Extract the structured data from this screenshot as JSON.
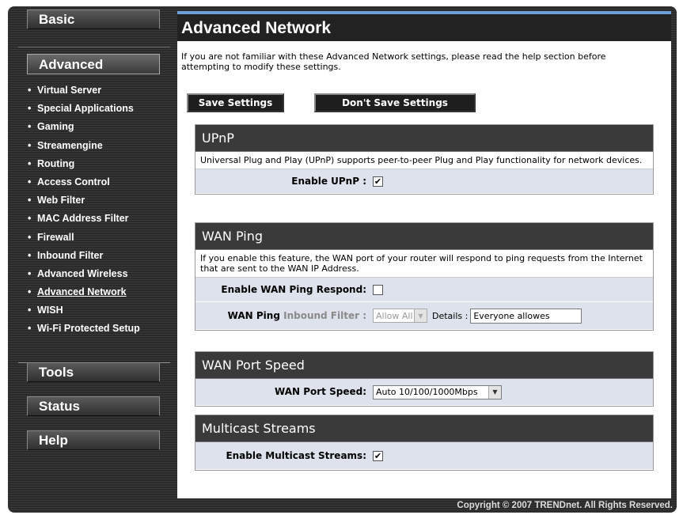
{
  "nav": {
    "basic": "Basic",
    "advanced": "Advanced",
    "tools": "Tools",
    "status": "Status",
    "help": "Help",
    "bullet": "•",
    "submenu": [
      {
        "label": "Virtual Server"
      },
      {
        "label": "Special Applications"
      },
      {
        "label": "Gaming"
      },
      {
        "label": "Streamengine"
      },
      {
        "label": "Routing"
      },
      {
        "label": "Access Control"
      },
      {
        "label": "Web Filter"
      },
      {
        "label": "MAC Address Filter"
      },
      {
        "label": "Firewall"
      },
      {
        "label": "Inbound Filter"
      },
      {
        "label": "Advanced Wireless"
      },
      {
        "label": "Advanced Network",
        "active": true
      },
      {
        "label": "WISH"
      },
      {
        "label": "Wi-Fi Protected Setup"
      }
    ]
  },
  "page": {
    "title": "Advanced Network",
    "intro": "If you are not familiar with these Advanced Network settings, please read the help section before attempting to modify these settings.",
    "save_label": "Save Settings",
    "dont_save_label": "Don't Save Settings"
  },
  "upnp": {
    "heading": "UPnP",
    "description": "Universal Plug and Play (UPnP) supports peer-to-peer Plug and Play functionality for network devices.",
    "enable_label": "Enable UPnP :",
    "enabled": true
  },
  "wan_ping": {
    "heading": "WAN Ping",
    "description": "If you enable this feature, the WAN port of your router will respond to ping requests from the Internet that are sent to the WAN IP Address.",
    "respond_label": "Enable WAN Ping Respond:",
    "respond_enabled": false,
    "filter_label_bold": "WAN Ping",
    "filter_label_muted": "Inbound Filter :",
    "filter_value": "Allow All",
    "details_label": "Details :",
    "details_value": "Everyone allowes"
  },
  "wan_speed": {
    "heading": "WAN Port Speed",
    "label": "WAN Port Speed:",
    "value": "Auto 10/100/1000Mbps"
  },
  "multicast": {
    "heading": "Multicast Streams",
    "label": "Enable Multicast Streams:",
    "enabled": true
  },
  "footer": {
    "copyright": "Copyright © 2007 TRENDnet. All Rights Reserved."
  },
  "icons": {
    "check": "check-icon",
    "dropdown": "dropdown-arrow-icon"
  },
  "colors": {
    "accent": "#6f9fd8",
    "section_header": "#3a3a3a",
    "row_bg": "#dde2ec"
  }
}
